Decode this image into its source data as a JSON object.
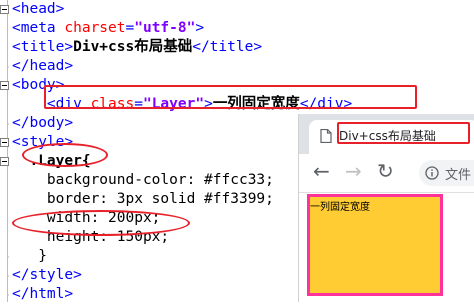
{
  "editor": {
    "lines": [
      {
        "parts": [
          [
            "tag",
            "<head>"
          ]
        ],
        "fold": "minus"
      },
      {
        "parts": [
          [
            "tag",
            "<meta "
          ],
          [
            "attr",
            "charset"
          ],
          [
            "tag",
            "="
          ],
          [
            "str",
            "\"utf-8\""
          ],
          [
            "tag",
            ">"
          ]
        ],
        "fold": "line"
      },
      {
        "parts": [
          [
            "tag",
            "<title>"
          ],
          [
            "txt",
            "Div+css布局基础"
          ],
          [
            "tag",
            "</title>"
          ]
        ],
        "fold": "line"
      },
      {
        "parts": [
          [
            "tag",
            "</head>"
          ]
        ],
        "fold": "end"
      },
      {
        "parts": [
          [
            "tag",
            "<body>"
          ]
        ],
        "fold": "minus"
      },
      {
        "parts": [
          [
            "tag",
            "    <div "
          ],
          [
            "attr",
            "class"
          ],
          [
            "tag",
            "="
          ],
          [
            "str",
            "\"Layer\""
          ],
          [
            "tag",
            ">"
          ],
          [
            "txt",
            "一列固定宽度"
          ],
          [
            "tag",
            "</div>"
          ]
        ],
        "fold": "line"
      },
      {
        "parts": [
          [
            "tag",
            "</body>"
          ]
        ],
        "fold": "end"
      },
      {
        "parts": [
          [
            "tag",
            "<style>"
          ]
        ],
        "fold": "minus"
      },
      {
        "parts": [
          [
            "txt",
            "  .Layer{"
          ]
        ],
        "fold": "minus"
      },
      {
        "parts": [
          [
            "prop",
            "    background-color: #ffcc33;"
          ]
        ],
        "fold": "line"
      },
      {
        "parts": [
          [
            "prop",
            "    border: 3px solid #ff3399;"
          ]
        ],
        "fold": "line"
      },
      {
        "parts": [
          [
            "prop",
            "    width: 200px;"
          ]
        ],
        "fold": "line"
      },
      {
        "parts": [
          [
            "prop",
            "    height: 150px;"
          ]
        ],
        "fold": "line"
      },
      {
        "parts": [
          [
            "prop",
            "   }"
          ]
        ],
        "fold": "end"
      },
      {
        "parts": [
          [
            "tag",
            "</style>"
          ]
        ],
        "fold": "end"
      },
      {
        "parts": [
          [
            "tag",
            "</html>"
          ]
        ],
        "fold": "end"
      }
    ]
  },
  "browser": {
    "tab_title": "Div+css布局基础",
    "address_text": "文件",
    "page_text": "一列固定宽度"
  },
  "colors": {
    "highlight": "#e8202a",
    "layer_bg": "#ffcc33",
    "layer_border": "#ff3399"
  }
}
